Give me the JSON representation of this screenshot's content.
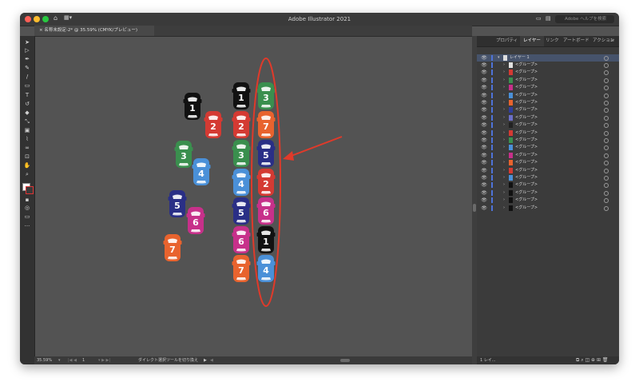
{
  "app": {
    "title": "Adobe Illustrator 2021",
    "search_placeholder": "Adobe ヘルプを検索"
  },
  "document": {
    "tab_label": "名称未設定-2* @ 35.59% (CMYK/プレビュー)"
  },
  "toolbar": {
    "tools": [
      "select",
      "direct-select",
      "pen",
      "pencil",
      "brush",
      "rect",
      "type",
      "rotate",
      "eraser",
      "scale",
      "gradient",
      "eyedropper",
      "blend",
      "artboard",
      "hand",
      "zoom"
    ]
  },
  "panel": {
    "tabs": [
      "プロパティ",
      "レイヤー",
      "リンク",
      "アートボード",
      "アクション"
    ],
    "active_tab": "レイヤー",
    "layer_name": "レイヤー 1",
    "group_label": "<グループ>",
    "group_colors": [
      "#e0e0e0",
      "#d43a33",
      "#3a8f4e",
      "#c7308a",
      "#4a90d8",
      "#e8632e",
      "#2f3d9a",
      "#6b6fc7",
      "#222222",
      "#d43a33",
      "#3a8f4e",
      "#4a90d8",
      "#c7308a",
      "#e8632e",
      "#d43a33",
      "#4a90d8",
      "#111111",
      "#111111",
      "#111111",
      "#111111"
    ],
    "footer_label": "1 レイ..."
  },
  "status": {
    "zoom": "35.59%",
    "artboard_num": "1",
    "tool_hint": "ダイレクト選択ツールを切り換え"
  },
  "cars": {
    "loose": [
      {
        "num": "1",
        "color": "#111111"
      },
      {
        "num": "2",
        "color": "#d43a33"
      },
      {
        "num": "3",
        "color": "#3a8f4e"
      },
      {
        "num": "4",
        "color": "#4a90d8"
      },
      {
        "num": "5",
        "color": "#2a2f86"
      },
      {
        "num": "6",
        "color": "#c7308a"
      },
      {
        "num": "7",
        "color": "#e8632e"
      }
    ],
    "column_left": [
      {
        "num": "1",
        "color": "#111111"
      },
      {
        "num": "2",
        "color": "#d43a33"
      },
      {
        "num": "3",
        "color": "#3a8f4e"
      },
      {
        "num": "4",
        "color": "#4a90d8"
      },
      {
        "num": "5",
        "color": "#2a2f86"
      },
      {
        "num": "6",
        "color": "#c7308a"
      },
      {
        "num": "7",
        "color": "#e8632e"
      }
    ],
    "column_right": [
      {
        "num": "3",
        "color": "#3a8f4e"
      },
      {
        "num": "7",
        "color": "#e8632e"
      },
      {
        "num": "5",
        "color": "#2a2f86"
      },
      {
        "num": "2",
        "color": "#d43a33"
      },
      {
        "num": "6",
        "color": "#c7308a"
      },
      {
        "num": "1",
        "color": "#111111"
      },
      {
        "num": "4",
        "color": "#4a90d8"
      }
    ]
  },
  "annotation": {
    "ellipse_color": "#e03a2a",
    "arrow_color": "#e03a2a"
  }
}
